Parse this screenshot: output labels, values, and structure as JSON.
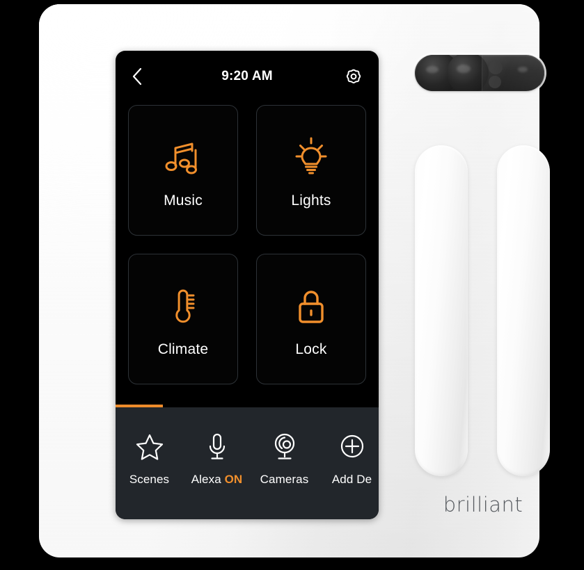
{
  "device": {
    "brand": "brilliant",
    "sensor_pill_name": "camera-sensor-module"
  },
  "screen": {
    "header": {
      "back_icon": "chevron-left-icon",
      "time": "9:20 AM",
      "settings_icon": "gear-icon"
    },
    "tiles": [
      {
        "id": "music",
        "label": "Music",
        "icon": "music-note-icon",
        "accent": "#f18f2c"
      },
      {
        "id": "lights",
        "label": "Lights",
        "icon": "light-bulb-icon",
        "accent": "#f18f2c"
      },
      {
        "id": "climate",
        "label": "Climate",
        "icon": "thermometer-icon",
        "accent": "#f18f2c"
      },
      {
        "id": "lock",
        "label": "Lock",
        "icon": "padlock-icon",
        "accent": "#f18f2c"
      }
    ],
    "page_indicator": {
      "color": "#ed8b2b",
      "position": "left"
    },
    "navbar": {
      "background": "#22262b",
      "items": [
        {
          "id": "scenes",
          "label": "Scenes",
          "status": "",
          "icon": "star-icon"
        },
        {
          "id": "alexa",
          "label": "Alexa",
          "status": "ON",
          "icon": "microphone-icon"
        },
        {
          "id": "cameras",
          "label": "Cameras",
          "status": "",
          "icon": "camera-icon"
        },
        {
          "id": "add-device",
          "label": "Add De",
          "status": "",
          "icon": "plus-circle-icon"
        }
      ]
    }
  },
  "controls": {
    "slider_left_name": "dimmer-slider-left",
    "slider_right_name": "dimmer-slider-right"
  },
  "colors": {
    "accent_orange": "#f18f2c",
    "indicator_orange": "#ed8b2b",
    "screen_black": "#000000",
    "navbar_dark": "#22262b",
    "tile_border": "#2d3237",
    "panel_white": "#ffffff",
    "brand_gray": "#55595e"
  }
}
